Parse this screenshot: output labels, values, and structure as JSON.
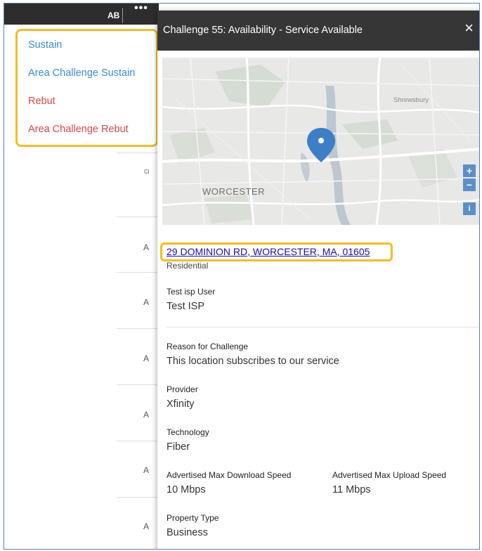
{
  "background_table": {
    "header_label": "AB",
    "more_label": "•••",
    "row_labels": [
      "Cl",
      "A",
      "A",
      "A",
      "A",
      "A",
      "A"
    ]
  },
  "menu": {
    "items": [
      {
        "label": "Sustain",
        "color": "#3a8cd0"
      },
      {
        "label": "Area Challenge Sustain",
        "color": "#3a8cd0"
      },
      {
        "label": "Rebut",
        "color": "#d1494a"
      },
      {
        "label": "Area Challenge Rebut",
        "color": "#d1494a"
      }
    ]
  },
  "panel": {
    "title": "Challenge 55:  Availability - Service Available",
    "close_icon": "×",
    "map": {
      "city_label": "WORCESTER",
      "town_label": "Shrewsbury",
      "zoom_in": "+",
      "zoom_out": "−",
      "info": "i"
    },
    "address": "29 DOMINION RD, WORCESTER, MA, 01605",
    "address_type": "Residential",
    "fields": {
      "user_label": "Test isp User",
      "user_value": "Test ISP",
      "reason_label": "Reason for Challenge",
      "reason_value": "This location subscribes to our service",
      "provider_label": "Provider",
      "provider_value": "Xfinity",
      "technology_label": "Technology",
      "technology_value": "Fiber",
      "download_label": "Advertised Max Download Speed",
      "download_value": "10 Mbps",
      "upload_label": "Advertised Max Upload Speed",
      "upload_value": "11 Mbps",
      "property_label": "Property Type",
      "property_value": "Business"
    }
  },
  "colors": {
    "highlight": "#f0bd25",
    "header_dark": "#363636",
    "link": "#1a0dab",
    "sustain": "#3a8cd0",
    "rebut": "#d1494a",
    "map_pin": "#3d7fc6"
  }
}
